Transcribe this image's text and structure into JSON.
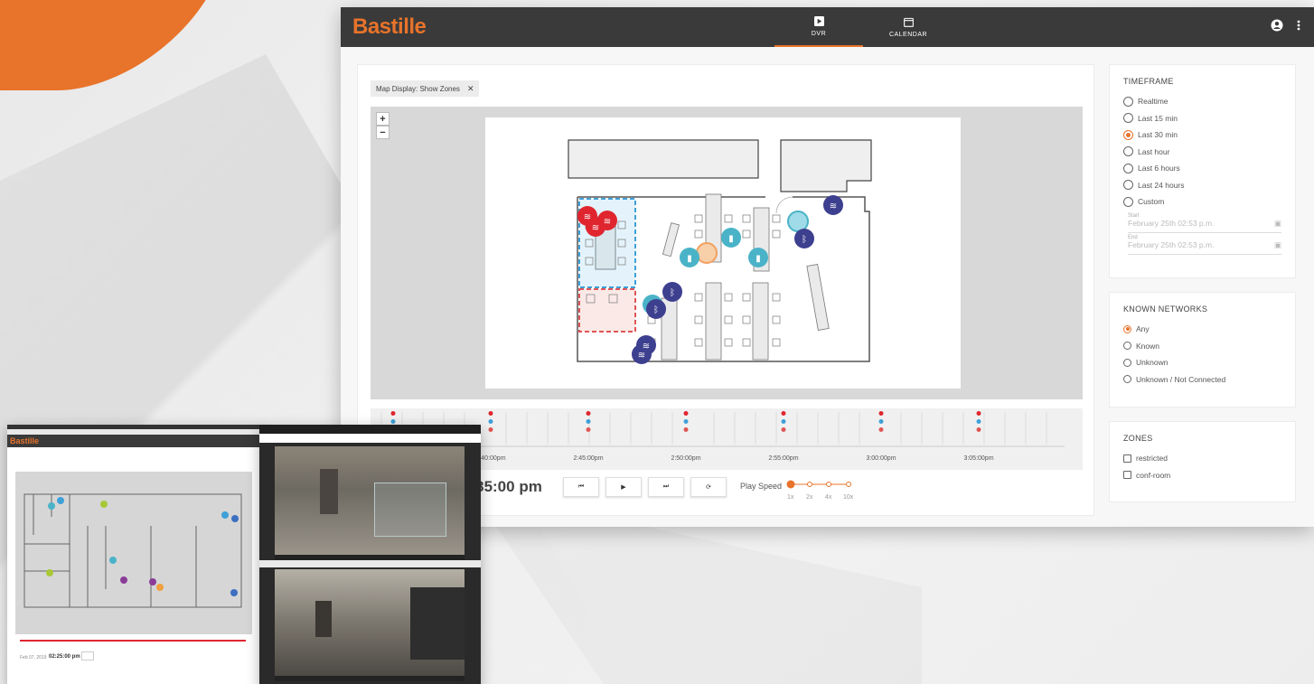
{
  "app": {
    "logo": "Bastille"
  },
  "nav": {
    "tabs": [
      {
        "label": "DVR",
        "icon": "video-icon",
        "active": true
      },
      {
        "label": "CALENDAR",
        "icon": "calendar-icon",
        "active": false
      }
    ]
  },
  "filter_chip": {
    "label": "Map Display: Show Zones",
    "close": "✕"
  },
  "map_controls": {
    "zoom_in": "+",
    "zoom_out": "−"
  },
  "timeline": {
    "labels": [
      "2:40:00pm",
      "2:45:00pm",
      "2:50:00pm",
      "2:55:00pm",
      "3:00:00pm",
      "3:05:00pm"
    ],
    "clock": "2:35:00 pm",
    "play_speed_label": "Play Speed",
    "speeds": [
      "1x",
      "2x",
      "4x",
      "10x"
    ],
    "selected_speed": "1x",
    "buttons": [
      "skip-back",
      "play",
      "skip-forward",
      "refresh"
    ]
  },
  "timeframe": {
    "title": "TIMEFRAME",
    "options": [
      "Realtime",
      "Last 15 min",
      "Last 30 min",
      "Last hour",
      "Last 6 hours",
      "Last 24 hours",
      "Custom"
    ],
    "selected": "Last 30 min",
    "start_label": "Start",
    "start_value": "February 25th 02:53 p.m.",
    "end_label": "End",
    "end_value": "February 25th 02:53 p.m."
  },
  "known_networks": {
    "title": "KNOWN NETWORKS",
    "options": [
      "Any",
      "Known",
      "Unknown",
      "Unknown / Not Connected"
    ],
    "selected": "Any"
  },
  "zones": {
    "title": "ZONES",
    "options": [
      "restricted",
      "conf-room"
    ]
  },
  "mini_window": {
    "logo": "Bastille",
    "date": "Feb 07, 2019",
    "time": "02:25:00 pm"
  },
  "colors": {
    "accent": "#e8732a",
    "topbar": "#3a3a3a",
    "wifi_red": "#e0252f",
    "wifi_navy": "#3d3f8f",
    "cellular_teal": "#4ab3c8",
    "zone_blue": "#3ea0d8",
    "zone_red": "#e05555"
  }
}
